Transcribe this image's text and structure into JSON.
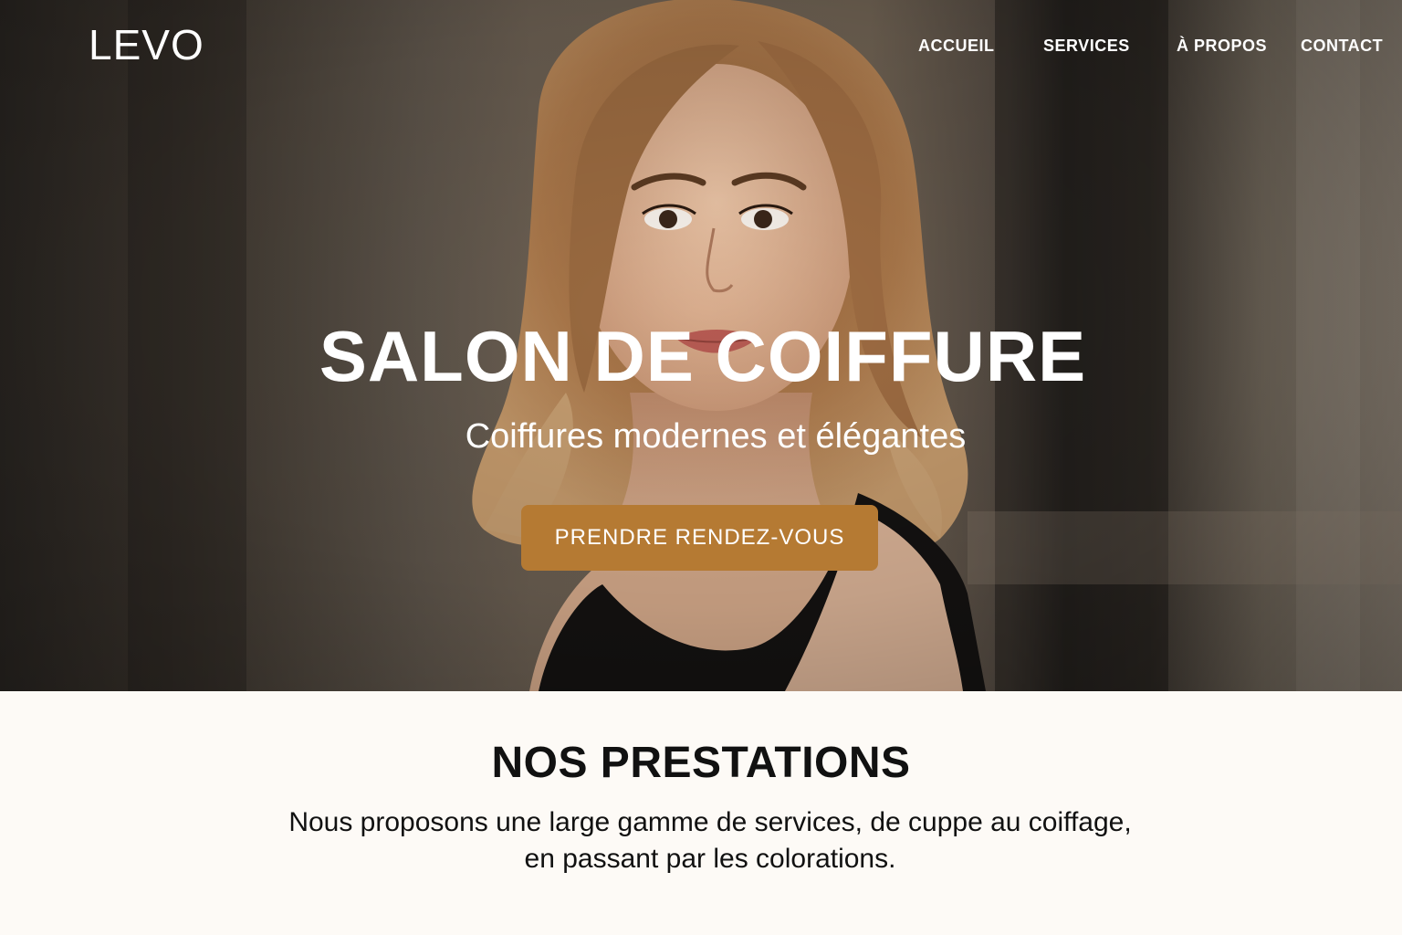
{
  "brand": {
    "logo": "LEVO"
  },
  "nav": {
    "items": [
      {
        "label": "ACCUEIL"
      },
      {
        "label": "SERVICES"
      },
      {
        "label": "À PROPOS"
      },
      {
        "label": "CONTACT"
      }
    ]
  },
  "hero": {
    "title": "SALON DE COIFFURE",
    "subtitle": "Coiffures modernes et élégantes",
    "cta_label": "PRENDRE RENDEZ-VOUS"
  },
  "services": {
    "title": "NOS PRESTATIONS",
    "text_line1": "Nous proposons une large gamme de services, de cuppe au coiffage,",
    "text_line2": "en passant par les colorations."
  },
  "colors": {
    "accent": "#b57a33",
    "section_bg": "#fdfaf6",
    "text_dark": "#111111"
  }
}
